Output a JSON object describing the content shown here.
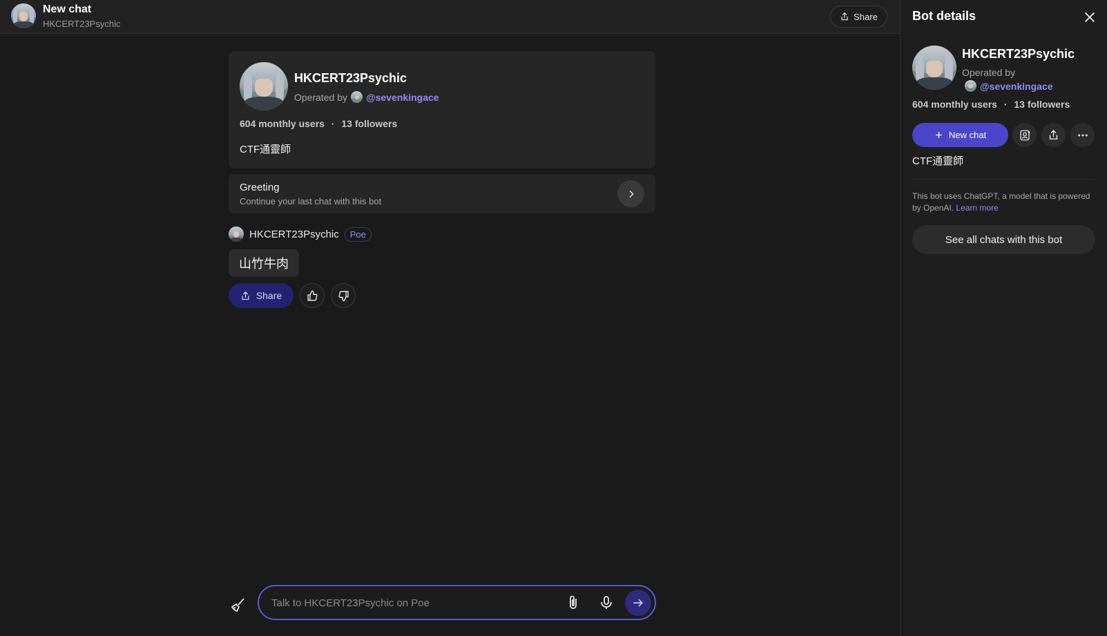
{
  "header": {
    "title": "New chat",
    "subtitle": "HKCERT23Psychic",
    "share_label": "Share"
  },
  "bot_card": {
    "name": "HKCERT23Psychic",
    "operated_by_label": "Operated by",
    "operator_handle": "@sevenkingace",
    "monthly_users": "604 monthly users",
    "separator": "·",
    "followers": "13 followers",
    "description": "CTF通靈師"
  },
  "greeting": {
    "title": "Greeting",
    "subtitle": "Continue your last chat with this bot"
  },
  "message": {
    "sender": "HKCERT23Psychic",
    "badge": "Poe",
    "text": "山竹牛肉",
    "share_label": "Share"
  },
  "composer": {
    "placeholder": "Talk to HKCERT23Psychic on Poe",
    "value": ""
  },
  "panel": {
    "title": "Bot details",
    "name": "HKCERT23Psychic",
    "operated_by_label": "Operated by",
    "operator_handle": "@sevenkingace",
    "monthly_users": "604 monthly users",
    "separator": "·",
    "followers": "13 followers",
    "new_chat_label": "New chat",
    "description": "CTF通靈師",
    "note_text": "This bot uses ChatGPT, a model that is powered by OpenAI.",
    "learn_more": "Learn more",
    "see_all_label": "See all chats with this bot"
  },
  "colors": {
    "accent": "#4a45c9",
    "link": "#8e8cf5",
    "background": "#1a1a1a",
    "panel_bg": "#1e1e1e",
    "card_bg": "#262626"
  },
  "icons": [
    "share-icon",
    "close-icon",
    "chevron-right-icon",
    "thumbs-up-icon",
    "thumbs-down-icon",
    "broom-icon",
    "paperclip-icon",
    "microphone-icon",
    "arrow-right-icon",
    "plus-icon",
    "add-user-icon",
    "more-icon"
  ]
}
